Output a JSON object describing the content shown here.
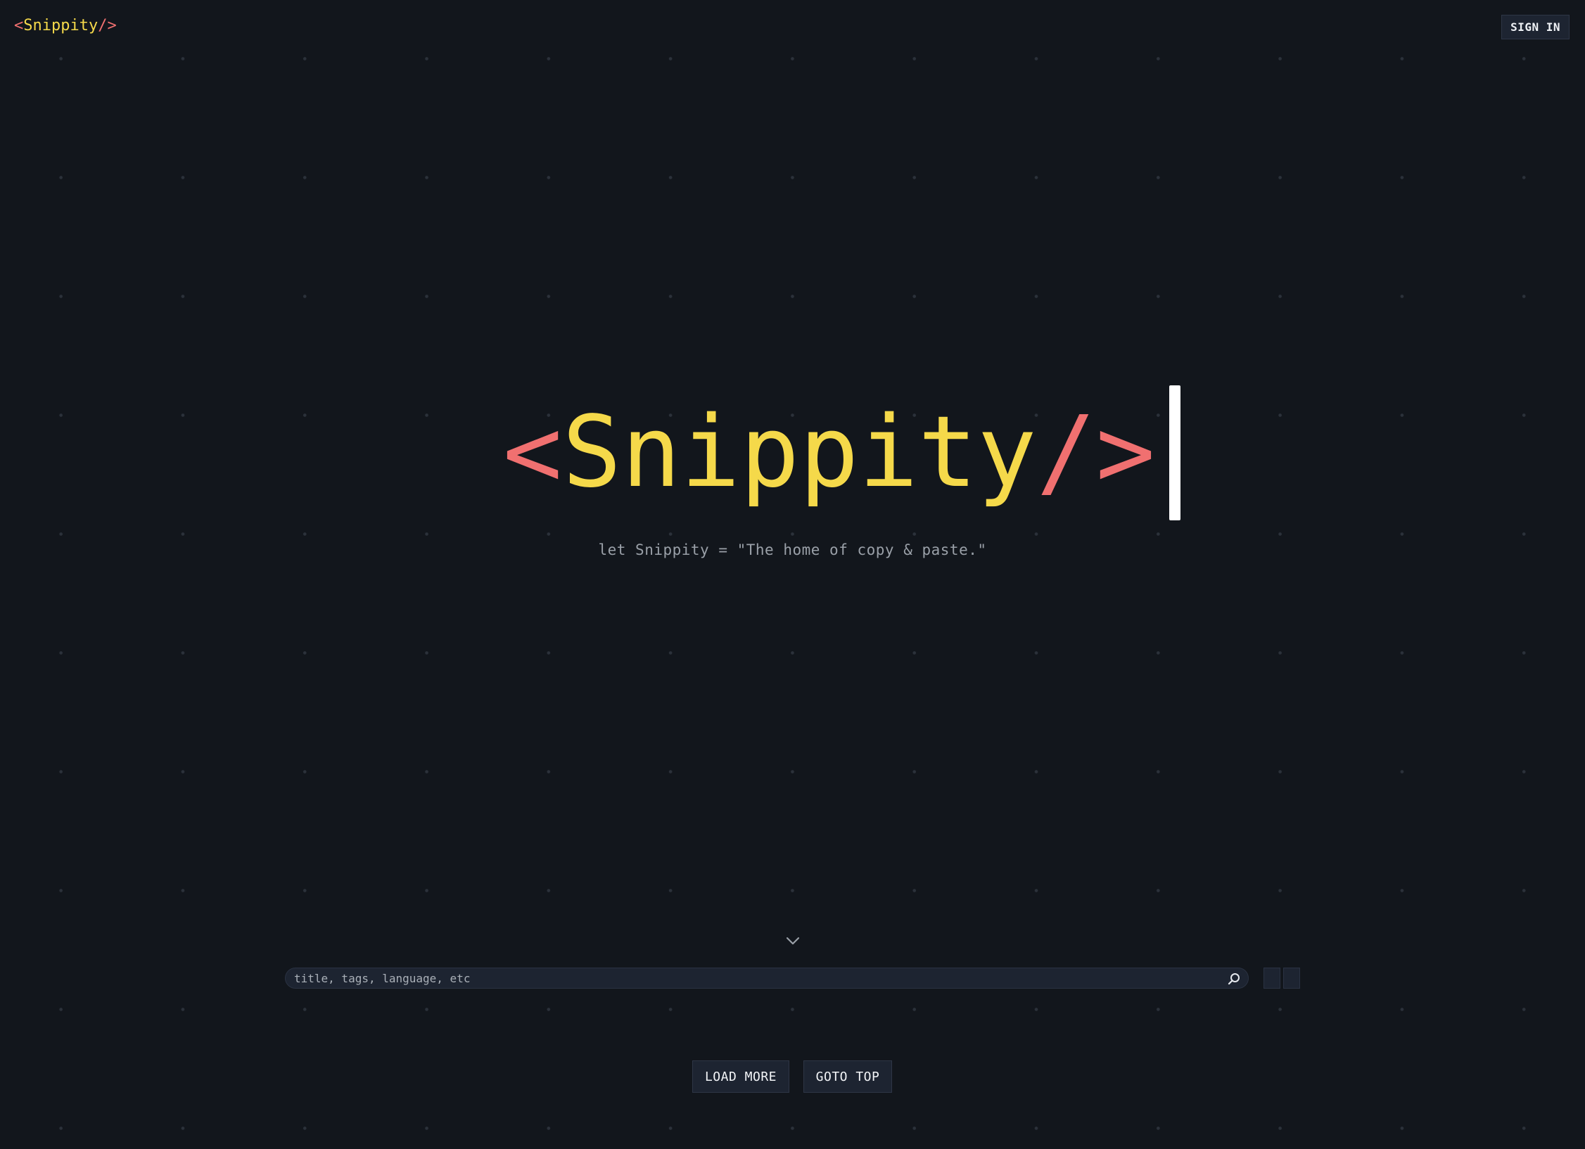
{
  "header": {
    "logo": {
      "open": "<",
      "name": "Snippity",
      "close": "/>"
    },
    "sign_in_label": "SIGN IN"
  },
  "hero": {
    "open": "<",
    "name": "Snippity",
    "slash": "/",
    "close": ">",
    "tagline": "let Snippity = \"The home of copy & paste.\""
  },
  "search": {
    "placeholder": "title, tags, language, etc",
    "value": ""
  },
  "actions": {
    "load_more_label": "LOAD MORE",
    "goto_top_label": "GOTO TOP"
  },
  "colors": {
    "background": "#12161c",
    "accent_red": "#f07070",
    "accent_yellow": "#f5d94a",
    "surface": "#1d2431"
  },
  "icons": {
    "scroll_down": "chevron-down-icon",
    "search": "search-icon"
  }
}
